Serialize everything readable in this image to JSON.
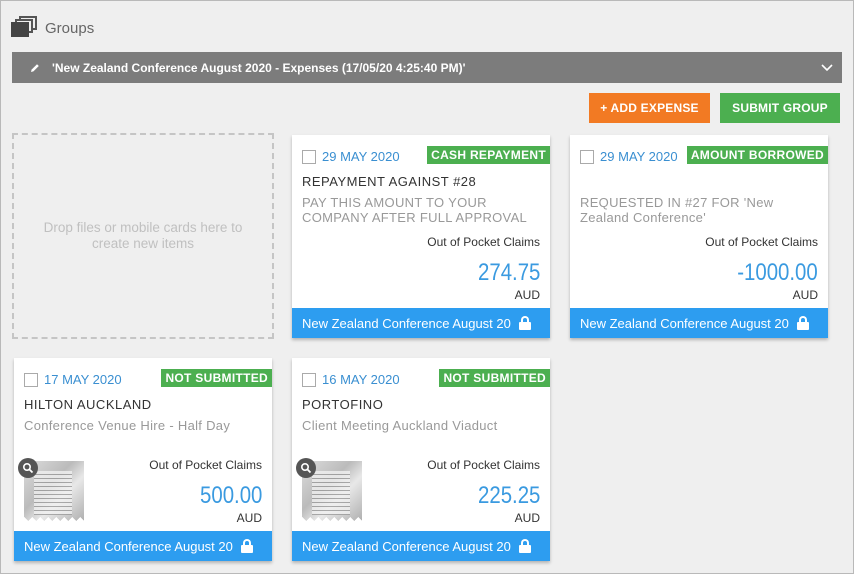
{
  "header": {
    "title": "Groups",
    "icon": "groups-icon"
  },
  "group_bar": {
    "name": "'New Zealand Conference August 2020 - Expenses (17/05/20 4:25:40 PM)'",
    "icon": "pencil-icon",
    "toggle_icon": "chevron-down-icon"
  },
  "toolbar": {
    "add_label": "+ ADD EXPENSE",
    "submit_label": "SUBMIT GROUP",
    "add_color": "#f27a23",
    "submit_color": "#4caf50"
  },
  "dropzone": {
    "text": "Drop files or mobile cards here to create new items"
  },
  "cards": [
    {
      "date": "29 MAY 2020",
      "badge": "CASH REPAYMENT",
      "title": "REPAYMENT AGAINST #28",
      "description": "PAY THIS AMOUNT TO YOUR COMPANY AFTER FULL APPROVAL",
      "category": "Out of Pocket Claims",
      "amount": "274.75",
      "currency": "AUD",
      "footer": "New Zealand Conference August 20"
    },
    {
      "date": "29 MAY 2020",
      "badge": "AMOUNT BORROWED",
      "title": "",
      "description": "REQUESTED IN #27 FOR 'New Zealand Conference'",
      "category": "Out of Pocket Claims",
      "amount": "-1000.00",
      "currency": "AUD",
      "footer": "New Zealand Conference August 20"
    },
    {
      "date": "17 MAY 2020",
      "badge": "NOT SUBMITTED",
      "title": "HILTON AUCKLAND",
      "description": "Conference Venue Hire - Half Day",
      "category": "Out of Pocket Claims",
      "amount": "500.00",
      "currency": "AUD",
      "footer": "New Zealand Conference August 20"
    },
    {
      "date": "16 MAY 2020",
      "badge": "NOT SUBMITTED",
      "title": "PORTOFINO",
      "description": "Client Meeting Auckland Viaduct",
      "category": "Out of Pocket Claims",
      "amount": "225.25",
      "currency": "AUD",
      "footer": "New Zealand Conference August 20"
    }
  ],
  "colors": {
    "accent_blue": "#2d9df0",
    "badge_green": "#4caf50",
    "amount_blue": "#3a9ae0"
  }
}
